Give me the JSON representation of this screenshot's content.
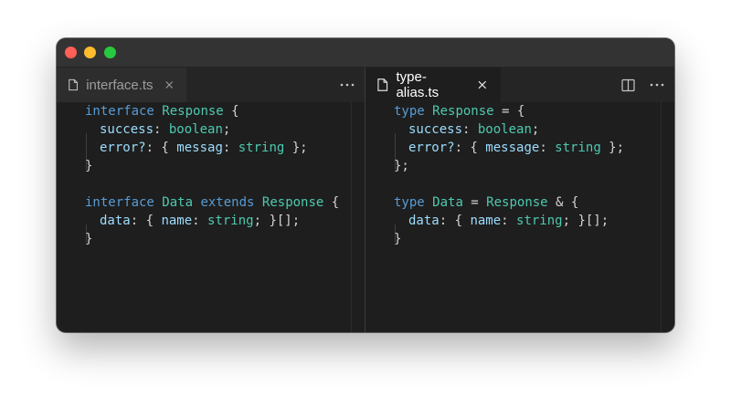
{
  "panes": [
    {
      "tab": {
        "filename": "interface.ts",
        "icon": "file-icon",
        "active": false
      },
      "actions": [
        {
          "icon": "more-icon",
          "label": "···"
        }
      ],
      "lines": [
        [
          {
            "t": "interface",
            "c": "kw"
          },
          {
            "t": " ",
            "c": "pu"
          },
          {
            "t": "Response",
            "c": "ty"
          },
          {
            "t": " {",
            "c": "pu"
          }
        ],
        [
          {
            "indent": 1
          },
          {
            "t": "success",
            "c": "pr"
          },
          {
            "t": ": ",
            "c": "pu"
          },
          {
            "t": "boolean",
            "c": "ty"
          },
          {
            "t": ";",
            "c": "pu"
          }
        ],
        [
          {
            "indent": 1
          },
          {
            "t": "error?",
            "c": "pr"
          },
          {
            "t": ": { ",
            "c": "pu"
          },
          {
            "t": "messag",
            "c": "pr"
          },
          {
            "t": ": ",
            "c": "pu"
          },
          {
            "t": "string",
            "c": "ty"
          },
          {
            "t": " };",
            "c": "pu"
          }
        ],
        [
          {
            "t": "}",
            "c": "pu"
          }
        ],
        [],
        [
          {
            "t": "interface",
            "c": "kw"
          },
          {
            "t": " ",
            "c": "pu"
          },
          {
            "t": "Data",
            "c": "ty"
          },
          {
            "t": " ",
            "c": "pu"
          },
          {
            "t": "extends",
            "c": "kw"
          },
          {
            "t": " ",
            "c": "pu"
          },
          {
            "t": "Response",
            "c": "ty"
          },
          {
            "t": " {",
            "c": "pu"
          }
        ],
        [
          {
            "indent": 1
          },
          {
            "t": "data",
            "c": "pr"
          },
          {
            "t": ": { ",
            "c": "pu"
          },
          {
            "t": "name",
            "c": "pr"
          },
          {
            "t": ": ",
            "c": "pu"
          },
          {
            "t": "string",
            "c": "ty"
          },
          {
            "t": "; }[];",
            "c": "pu"
          }
        ],
        [
          {
            "t": "}",
            "c": "pu"
          }
        ]
      ]
    },
    {
      "tab": {
        "filename": "type-alias.ts",
        "icon": "file-icon",
        "active": true
      },
      "actions": [
        {
          "icon": "split-editor-icon",
          "label": ""
        },
        {
          "icon": "more-icon",
          "label": "···"
        }
      ],
      "lines": [
        [
          {
            "t": "type",
            "c": "kw"
          },
          {
            "t": " ",
            "c": "pu"
          },
          {
            "t": "Response",
            "c": "ty"
          },
          {
            "t": " = {",
            "c": "pu"
          }
        ],
        [
          {
            "indent": 1
          },
          {
            "t": "success",
            "c": "pr"
          },
          {
            "t": ": ",
            "c": "pu"
          },
          {
            "t": "boolean",
            "c": "ty"
          },
          {
            "t": ";",
            "c": "pu"
          }
        ],
        [
          {
            "indent": 1
          },
          {
            "t": "error?",
            "c": "pr"
          },
          {
            "t": ": { ",
            "c": "pu"
          },
          {
            "t": "message",
            "c": "pr"
          },
          {
            "t": ": ",
            "c": "pu"
          },
          {
            "t": "string",
            "c": "ty"
          },
          {
            "t": " };",
            "c": "pu"
          }
        ],
        [
          {
            "t": "};",
            "c": "pu"
          }
        ],
        [],
        [
          {
            "t": "type",
            "c": "kw"
          },
          {
            "t": " ",
            "c": "pu"
          },
          {
            "t": "Data",
            "c": "ty"
          },
          {
            "t": " = ",
            "c": "pu"
          },
          {
            "t": "Response",
            "c": "ty"
          },
          {
            "t": " & {",
            "c": "pu"
          }
        ],
        [
          {
            "indent": 1
          },
          {
            "t": "data",
            "c": "pr"
          },
          {
            "t": ": { ",
            "c": "pu"
          },
          {
            "t": "name",
            "c": "pr"
          },
          {
            "t": ": ",
            "c": "pu"
          },
          {
            "t": "string",
            "c": "ty"
          },
          {
            "t": "; }[];",
            "c": "pu"
          }
        ],
        [
          {
            "t": "}",
            "c": "pu"
          }
        ]
      ]
    }
  ],
  "theme": {
    "keyword": "#569cd6",
    "type": "#4ec9b0",
    "property": "#9cdcfe",
    "punctuation": "#d4d4d4",
    "window_controls": {
      "close": "#fe5f57",
      "minimize": "#febc2e",
      "zoom": "#28c840"
    }
  }
}
